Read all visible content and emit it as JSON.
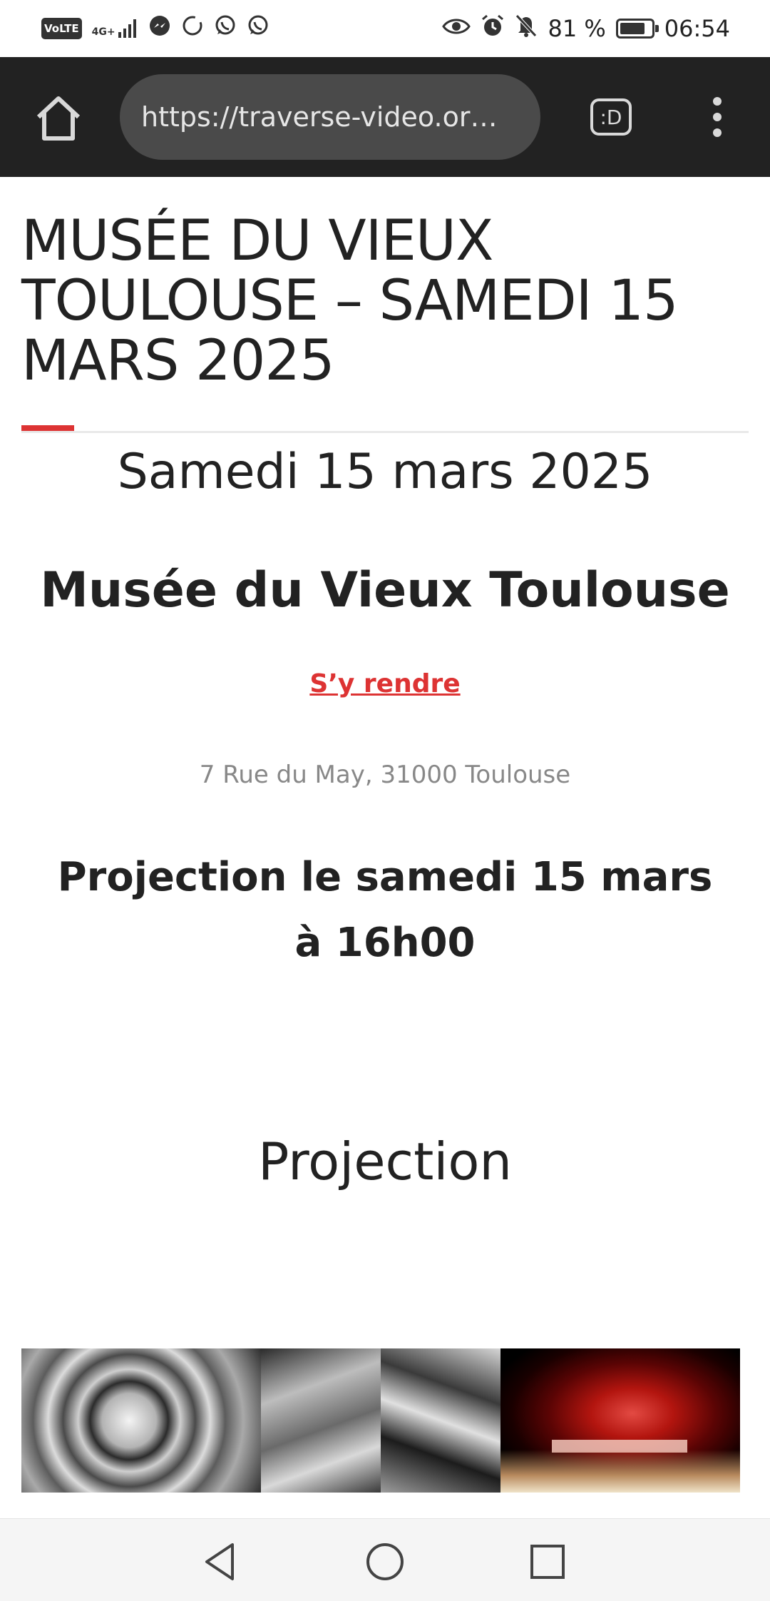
{
  "status_bar": {
    "carrier_badge": "VoLTE",
    "signal_label": "4G+",
    "battery_text": "81 %",
    "battery_level": 0.81,
    "time": "06:54",
    "left_icons": [
      "volte-icon",
      "signal-icon",
      "messenger-icon",
      "sync-icon",
      "whatsapp-icon",
      "whatsapp-icon"
    ],
    "right_icons": [
      "eye-icon",
      "alarm-icon",
      "muted-bell-icon",
      "battery-icon"
    ]
  },
  "browser": {
    "url": "https://traverse-video.or…",
    "tabs_label": ":D",
    "icons": [
      "home-icon",
      "tabs-icon",
      "menu-dots-icon"
    ]
  },
  "page": {
    "title": "MUSÉE DU VIEUX TOULOUSE – SAMEDI 15 MARS 2025",
    "date": "Samedi 15 mars 2025",
    "venue": "Musée du Vieux Toulouse",
    "directions_link": "S’y rendre",
    "address": "7 Rue du May, 31000 Toulouse",
    "projection_time": "Projection le samedi 15 mars à 16h00",
    "section_heading": "Projection",
    "accent_color": "#dd3333",
    "gallery": [
      "rose-thumbnail",
      "forest-path-thumbnail",
      "red-glow-thumbnail"
    ]
  },
  "nav_bar": {
    "icons": [
      "back-triangle-icon",
      "home-circle-icon",
      "recents-square-icon"
    ]
  }
}
